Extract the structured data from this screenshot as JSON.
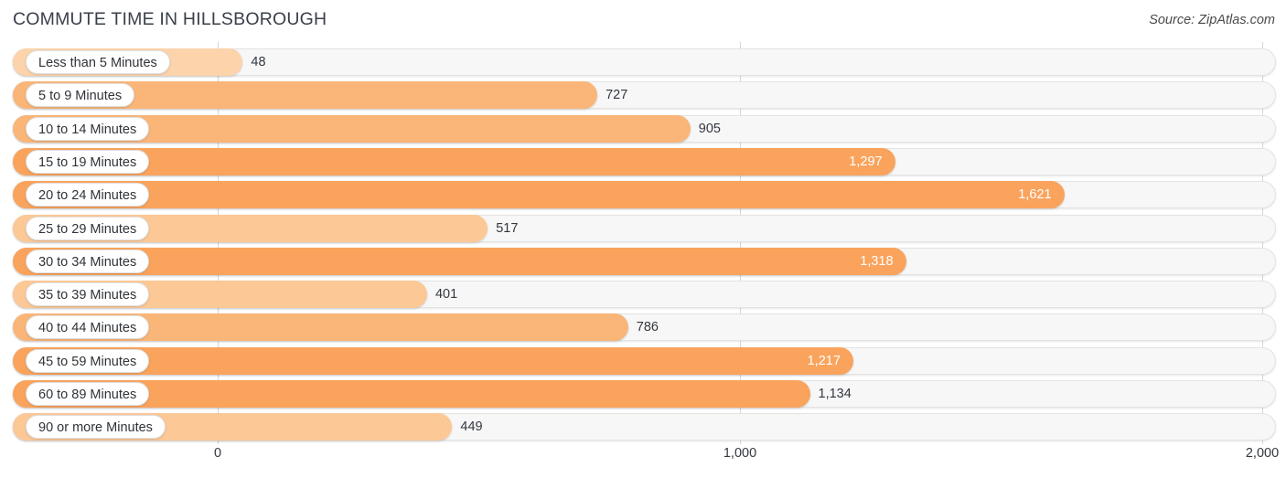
{
  "header": {
    "title": "COMMUTE TIME IN HILLSBOROUGH",
    "source": "Source: ZipAtlas.com"
  },
  "colors": {
    "bar_strong": "#f9a35c",
    "bar_mid": "#fab578",
    "bar_light": "#fcc896",
    "bar_lightest": "#fcd3ab",
    "track": "#f7f7f7",
    "gridline": "#d6d6d6",
    "value_text": "#33373f",
    "value_text_inside": "#ffffff"
  },
  "chart_data": {
    "type": "bar",
    "orientation": "horizontal",
    "title": "COMMUTE TIME IN HILLSBOROUGH",
    "xlabel": "",
    "ylabel": "",
    "xlim": [
      0,
      2000
    ],
    "grid": true,
    "legend": "none",
    "axis_ticks": [
      {
        "label": "0",
        "value": 0
      },
      {
        "label": "1,000",
        "value": 1000
      },
      {
        "label": "2,000",
        "value": 2000
      }
    ],
    "categories": [
      "Less than 5 Minutes",
      "5 to 9 Minutes",
      "10 to 14 Minutes",
      "15 to 19 Minutes",
      "20 to 24 Minutes",
      "25 to 29 Minutes",
      "30 to 34 Minutes",
      "35 to 39 Minutes",
      "40 to 44 Minutes",
      "45 to 59 Minutes",
      "60 to 89 Minutes",
      "90 or more Minutes"
    ],
    "values": [
      48,
      727,
      905,
      1297,
      1621,
      517,
      1318,
      401,
      786,
      1217,
      1134,
      449
    ],
    "value_labels": [
      "48",
      "727",
      "905",
      "1,297",
      "1,621",
      "517",
      "1,318",
      "401",
      "786",
      "1,217",
      "1,134",
      "449"
    ],
    "label_inside": [
      false,
      false,
      false,
      true,
      true,
      false,
      true,
      false,
      false,
      true,
      false,
      false
    ],
    "bar_colors": [
      "#fcd3ab",
      "#fab578",
      "#fab578",
      "#f9a35c",
      "#f9a35c",
      "#fcc896",
      "#f9a35c",
      "#fcc896",
      "#fab578",
      "#f9a35c",
      "#f9a35c",
      "#fcc896"
    ]
  }
}
